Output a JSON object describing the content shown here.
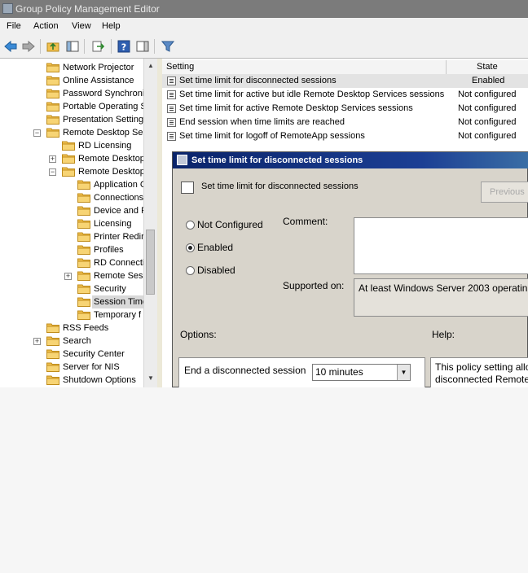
{
  "window": {
    "title": "Group Policy Management Editor"
  },
  "menu": [
    "File",
    "Action",
    "View",
    "Help"
  ],
  "toolbar": {
    "icons": [
      "back-arrow-icon",
      "forward-arrow-icon",
      "up-folder-icon",
      "show-hide-tree-icon",
      "export-list-icon",
      "help-icon",
      "action-pane-icon",
      "filter-icon"
    ]
  },
  "tree": [
    {
      "label": "Network Projector",
      "indent": 0
    },
    {
      "label": "Online Assistance",
      "indent": 0
    },
    {
      "label": "Password Synchroniz",
      "indent": 0
    },
    {
      "label": "Portable Operating S",
      "indent": 0
    },
    {
      "label": "Presentation Setting",
      "indent": 0
    },
    {
      "label": "Remote Desktop Ser",
      "indent": 0,
      "exp": "−"
    },
    {
      "label": "RD Licensing",
      "indent": 1
    },
    {
      "label": "Remote Desktop",
      "indent": 1,
      "exp": "+"
    },
    {
      "label": "Remote Desktop",
      "indent": 1,
      "exp": "−"
    },
    {
      "label": "Application C",
      "indent": 2
    },
    {
      "label": "Connections",
      "indent": 2
    },
    {
      "label": "Device and R",
      "indent": 2
    },
    {
      "label": "Licensing",
      "indent": 2
    },
    {
      "label": "Printer Redir",
      "indent": 2
    },
    {
      "label": "Profiles",
      "indent": 2
    },
    {
      "label": "RD Connecti",
      "indent": 2
    },
    {
      "label": "Remote Sess",
      "indent": 2,
      "exp": "+"
    },
    {
      "label": "Security",
      "indent": 2
    },
    {
      "label": "Session Time",
      "indent": 2,
      "selected": true
    },
    {
      "label": "Temporary f",
      "indent": 2
    },
    {
      "label": "RSS Feeds",
      "indent": 0
    },
    {
      "label": "Search",
      "indent": 0,
      "exp": "+"
    },
    {
      "label": "Security Center",
      "indent": 0
    },
    {
      "label": "Server for NIS",
      "indent": 0
    },
    {
      "label": "Shutdown Options",
      "indent": 0
    }
  ],
  "list": {
    "headers": {
      "setting": "Setting",
      "state": "State"
    },
    "rows": [
      {
        "name": "Set time limit for disconnected sessions",
        "state": "Enabled",
        "selected": true
      },
      {
        "name": "Set time limit for active but idle Remote Desktop Services sessions",
        "state": "Not configured"
      },
      {
        "name": "Set time limit for active Remote Desktop Services sessions",
        "state": "Not configured"
      },
      {
        "name": "End session when time limits are reached",
        "state": "Not configured"
      },
      {
        "name": "Set time limit for logoff of RemoteApp sessions",
        "state": "Not configured"
      }
    ]
  },
  "dialog": {
    "title": "Set time limit for disconnected sessions",
    "policy_name": "Set time limit for disconnected sessions",
    "previous_button": "Previous",
    "radio_not_configured": "Not Configured",
    "radio_enabled": "Enabled",
    "radio_disabled": "Disabled",
    "selected_option": "Enabled",
    "comment_label": "Comment:",
    "comment_value": "",
    "supported_label": "Supported on:",
    "supported_value": "At least Windows Server 2003 operating",
    "options_label": "Options:",
    "help_label": "Help:",
    "option_label": "End a disconnected session",
    "option_value": "10 minutes",
    "help_text_line1": "This policy setting allo",
    "help_text_line2": "disconnected Remote"
  },
  "colors": {
    "titlebar": "#7b7b7b",
    "dialog_title": "#0a246a",
    "folder": "#f1c04e"
  }
}
